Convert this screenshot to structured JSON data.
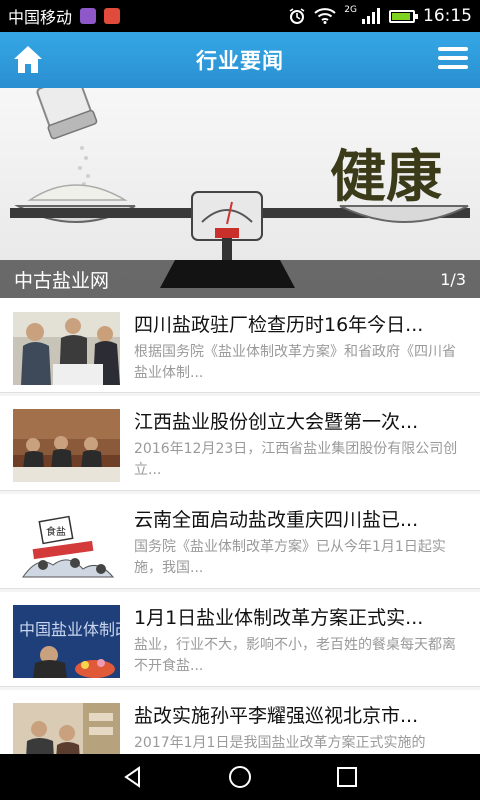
{
  "status_bar": {
    "carrier": "中国移动",
    "network_type": "2G",
    "time": "16:15"
  },
  "app_bar": {
    "title": "行业要闻",
    "home_icon": "home-icon",
    "menu_icon": "hamburger-menu-icon"
  },
  "banner": {
    "image_text": "健康",
    "caption": "中古盐业网",
    "page_indicator": "1/3"
  },
  "news": [
    {
      "title": "四川盐政驻厂检查历时16年今日...",
      "summary": "根据国务院《盐业体制改革方案》和省政府《四川省盐业体制..."
    },
    {
      "title": "江西盐业股份创立大会暨第一次...",
      "summary": "2016年12月23日，江西省盐业集团股份有限公司创立..."
    },
    {
      "title": "云南全面启动盐改重庆四川盐已...",
      "summary": "国务院《盐业体制改革方案》已从今年1月1日起实施，我国..."
    },
    {
      "title": "1月1日盐业体制改革方案正式实...",
      "summary": "盐业，行业不大，影响不小，老百姓的餐桌每天都离不开食盐..."
    },
    {
      "title": "盐改实施孙平李耀强巡视北京市...",
      "summary": "2017年1月1日是我国盐业改革方案正式实施的"
    }
  ],
  "thumb_texts": {
    "news3_sign": "食盐",
    "news4_banner": "中国盐业体制改革"
  },
  "colors": {
    "app_bar": "#2f9ad9",
    "status_bar": "#000000",
    "nav_bar": "#000000",
    "title_text": "#111111",
    "summary_text": "#9a9a9a"
  }
}
